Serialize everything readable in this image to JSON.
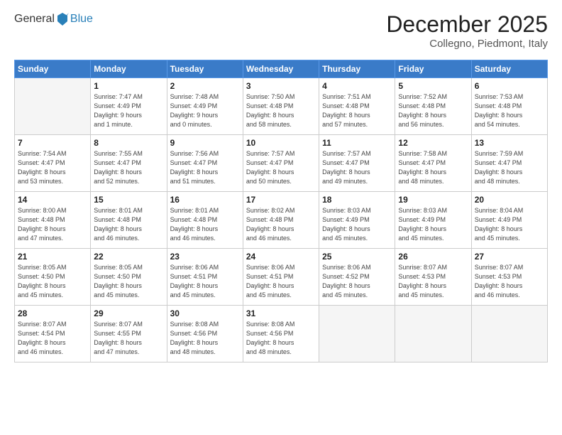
{
  "header": {
    "logo_general": "General",
    "logo_blue": "Blue",
    "month_title": "December 2025",
    "location": "Collegno, Piedmont, Italy"
  },
  "days_of_week": [
    "Sunday",
    "Monday",
    "Tuesday",
    "Wednesday",
    "Thursday",
    "Friday",
    "Saturday"
  ],
  "weeks": [
    [
      {
        "day": "",
        "info": ""
      },
      {
        "day": "1",
        "info": "Sunrise: 7:47 AM\nSunset: 4:49 PM\nDaylight: 9 hours\nand 1 minute."
      },
      {
        "day": "2",
        "info": "Sunrise: 7:48 AM\nSunset: 4:49 PM\nDaylight: 9 hours\nand 0 minutes."
      },
      {
        "day": "3",
        "info": "Sunrise: 7:50 AM\nSunset: 4:48 PM\nDaylight: 8 hours\nand 58 minutes."
      },
      {
        "day": "4",
        "info": "Sunrise: 7:51 AM\nSunset: 4:48 PM\nDaylight: 8 hours\nand 57 minutes."
      },
      {
        "day": "5",
        "info": "Sunrise: 7:52 AM\nSunset: 4:48 PM\nDaylight: 8 hours\nand 56 minutes."
      },
      {
        "day": "6",
        "info": "Sunrise: 7:53 AM\nSunset: 4:48 PM\nDaylight: 8 hours\nand 54 minutes."
      }
    ],
    [
      {
        "day": "7",
        "info": "Sunrise: 7:54 AM\nSunset: 4:47 PM\nDaylight: 8 hours\nand 53 minutes."
      },
      {
        "day": "8",
        "info": "Sunrise: 7:55 AM\nSunset: 4:47 PM\nDaylight: 8 hours\nand 52 minutes."
      },
      {
        "day": "9",
        "info": "Sunrise: 7:56 AM\nSunset: 4:47 PM\nDaylight: 8 hours\nand 51 minutes."
      },
      {
        "day": "10",
        "info": "Sunrise: 7:57 AM\nSunset: 4:47 PM\nDaylight: 8 hours\nand 50 minutes."
      },
      {
        "day": "11",
        "info": "Sunrise: 7:57 AM\nSunset: 4:47 PM\nDaylight: 8 hours\nand 49 minutes."
      },
      {
        "day": "12",
        "info": "Sunrise: 7:58 AM\nSunset: 4:47 PM\nDaylight: 8 hours\nand 48 minutes."
      },
      {
        "day": "13",
        "info": "Sunrise: 7:59 AM\nSunset: 4:47 PM\nDaylight: 8 hours\nand 48 minutes."
      }
    ],
    [
      {
        "day": "14",
        "info": "Sunrise: 8:00 AM\nSunset: 4:48 PM\nDaylight: 8 hours\nand 47 minutes."
      },
      {
        "day": "15",
        "info": "Sunrise: 8:01 AM\nSunset: 4:48 PM\nDaylight: 8 hours\nand 46 minutes."
      },
      {
        "day": "16",
        "info": "Sunrise: 8:01 AM\nSunset: 4:48 PM\nDaylight: 8 hours\nand 46 minutes."
      },
      {
        "day": "17",
        "info": "Sunrise: 8:02 AM\nSunset: 4:48 PM\nDaylight: 8 hours\nand 46 minutes."
      },
      {
        "day": "18",
        "info": "Sunrise: 8:03 AM\nSunset: 4:49 PM\nDaylight: 8 hours\nand 45 minutes."
      },
      {
        "day": "19",
        "info": "Sunrise: 8:03 AM\nSunset: 4:49 PM\nDaylight: 8 hours\nand 45 minutes."
      },
      {
        "day": "20",
        "info": "Sunrise: 8:04 AM\nSunset: 4:49 PM\nDaylight: 8 hours\nand 45 minutes."
      }
    ],
    [
      {
        "day": "21",
        "info": "Sunrise: 8:05 AM\nSunset: 4:50 PM\nDaylight: 8 hours\nand 45 minutes."
      },
      {
        "day": "22",
        "info": "Sunrise: 8:05 AM\nSunset: 4:50 PM\nDaylight: 8 hours\nand 45 minutes."
      },
      {
        "day": "23",
        "info": "Sunrise: 8:06 AM\nSunset: 4:51 PM\nDaylight: 8 hours\nand 45 minutes."
      },
      {
        "day": "24",
        "info": "Sunrise: 8:06 AM\nSunset: 4:51 PM\nDaylight: 8 hours\nand 45 minutes."
      },
      {
        "day": "25",
        "info": "Sunrise: 8:06 AM\nSunset: 4:52 PM\nDaylight: 8 hours\nand 45 minutes."
      },
      {
        "day": "26",
        "info": "Sunrise: 8:07 AM\nSunset: 4:53 PM\nDaylight: 8 hours\nand 45 minutes."
      },
      {
        "day": "27",
        "info": "Sunrise: 8:07 AM\nSunset: 4:53 PM\nDaylight: 8 hours\nand 46 minutes."
      }
    ],
    [
      {
        "day": "28",
        "info": "Sunrise: 8:07 AM\nSunset: 4:54 PM\nDaylight: 8 hours\nand 46 minutes."
      },
      {
        "day": "29",
        "info": "Sunrise: 8:07 AM\nSunset: 4:55 PM\nDaylight: 8 hours\nand 47 minutes."
      },
      {
        "day": "30",
        "info": "Sunrise: 8:08 AM\nSunset: 4:56 PM\nDaylight: 8 hours\nand 48 minutes."
      },
      {
        "day": "31",
        "info": "Sunrise: 8:08 AM\nSunset: 4:56 PM\nDaylight: 8 hours\nand 48 minutes."
      },
      {
        "day": "",
        "info": ""
      },
      {
        "day": "",
        "info": ""
      },
      {
        "day": "",
        "info": ""
      }
    ]
  ]
}
